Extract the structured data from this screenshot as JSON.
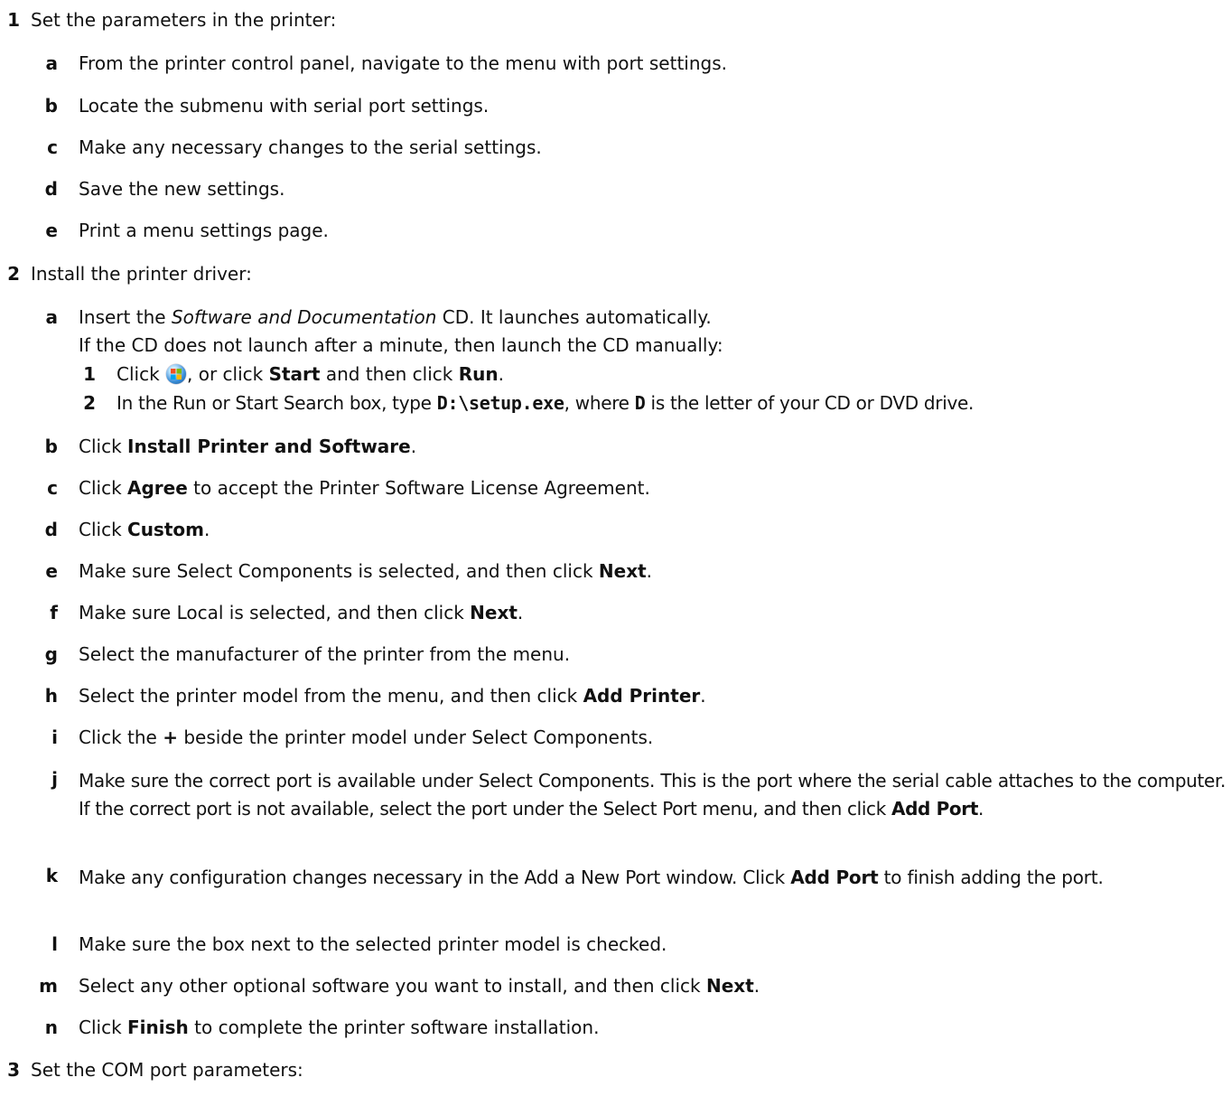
{
  "steps": [
    {
      "number": "1",
      "text": "Set the parameters in the printer:",
      "substeps": [
        {
          "letter": "a",
          "text": "From the printer control panel, navigate to the menu with port settings."
        },
        {
          "letter": "b",
          "text": "Locate the submenu with serial port settings."
        },
        {
          "letter": "c",
          "text": "Make any necessary changes to the serial settings."
        },
        {
          "letter": "d",
          "text": "Save the new settings."
        },
        {
          "letter": "e",
          "text": "Print a menu settings page."
        }
      ]
    },
    {
      "number": "2",
      "text": "Install the printer driver:",
      "substeps": {
        "a": {
          "letter": "a",
          "pre": "Insert the ",
          "italic": "Software and Documentation",
          "post": " CD. It launches automatically.",
          "note": "If the CD does not launch after a minute, then launch the CD manually:",
          "manual": [
            {
              "number": "1",
              "t1": "Click ",
              "icon": "windows-start-orb-icon",
              "t2": ", or click ",
              "b1": "Start",
              "t3": " and then click ",
              "b2": "Run",
              "t4": "."
            },
            {
              "number": "2",
              "t1": "In the Run or Start Search box, type ",
              "code1": "D:\\setup.exe",
              "t2": ", where ",
              "code2": "D",
              "t3": " is the letter of your CD or DVD drive."
            }
          ]
        },
        "b": {
          "letter": "b",
          "t1": "Click ",
          "b1": "Install Printer and Software",
          "t2": "."
        },
        "c": {
          "letter": "c",
          "t1": "Click ",
          "b1": "Agree",
          "t2": " to accept the Printer Software License Agreement."
        },
        "d": {
          "letter": "d",
          "t1": "Click ",
          "b1": "Custom",
          "t2": "."
        },
        "e": {
          "letter": "e",
          "t1": "Make sure Select Components is selected, and then click ",
          "b1": "Next",
          "t2": "."
        },
        "f": {
          "letter": "f",
          "t1": "Make sure Local is selected, and then click ",
          "b1": "Next",
          "t2": "."
        },
        "g": {
          "letter": "g",
          "text": "Select the manufacturer of the printer from the menu."
        },
        "h": {
          "letter": "h",
          "t1": "Select the printer model from the menu, and then click ",
          "b1": "Add Printer",
          "t2": "."
        },
        "i": {
          "letter": "i",
          "t1": "Click the ",
          "b1": "+",
          "t2": " beside the printer model under Select Components."
        },
        "j": {
          "letter": "j",
          "t1": "Make sure the correct port is available under Select Components. This is the port where the serial cable attaches to the computer. If the correct port is not available, select the port under the Select Port menu, and then click ",
          "b1": "Add Port",
          "t2": "."
        },
        "k": {
          "letter": "k",
          "t1": "Make any configuration changes necessary in the Add a New Port window. Click ",
          "b1": "Add Port",
          "t2": " to finish adding the port."
        },
        "l": {
          "letter": "l",
          "text": "Make sure the box next to the selected printer model is checked."
        },
        "m": {
          "letter": "m",
          "t1": "Select any other optional software you want to install, and then click ",
          "b1": "Next",
          "t2": "."
        },
        "n": {
          "letter": "n",
          "t1": "Click ",
          "b1": "Finish",
          "t2": " to complete the printer software installation."
        }
      }
    },
    {
      "number": "3",
      "text": "Set the COM port parameters:"
    }
  ]
}
